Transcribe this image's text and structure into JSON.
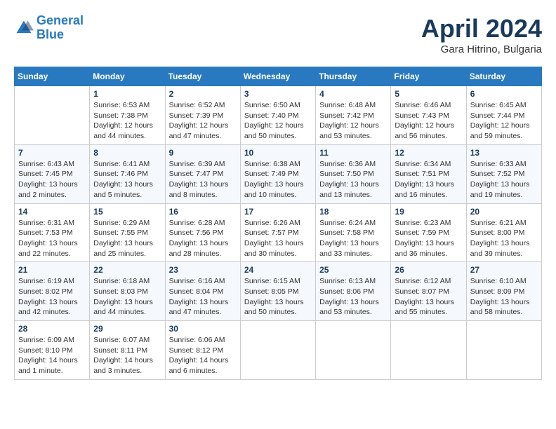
{
  "header": {
    "logo_line1": "General",
    "logo_line2": "Blue",
    "month_title": "April 2024",
    "subtitle": "Gara Hitrino, Bulgaria"
  },
  "weekdays": [
    "Sunday",
    "Monday",
    "Tuesday",
    "Wednesday",
    "Thursday",
    "Friday",
    "Saturday"
  ],
  "weeks": [
    [
      {
        "day": "",
        "sunrise": "",
        "sunset": "",
        "daylight": ""
      },
      {
        "day": "1",
        "sunrise": "Sunrise: 6:53 AM",
        "sunset": "Sunset: 7:38 PM",
        "daylight": "Daylight: 12 hours and 44 minutes."
      },
      {
        "day": "2",
        "sunrise": "Sunrise: 6:52 AM",
        "sunset": "Sunset: 7:39 PM",
        "daylight": "Daylight: 12 hours and 47 minutes."
      },
      {
        "day": "3",
        "sunrise": "Sunrise: 6:50 AM",
        "sunset": "Sunset: 7:40 PM",
        "daylight": "Daylight: 12 hours and 50 minutes."
      },
      {
        "day": "4",
        "sunrise": "Sunrise: 6:48 AM",
        "sunset": "Sunset: 7:42 PM",
        "daylight": "Daylight: 12 hours and 53 minutes."
      },
      {
        "day": "5",
        "sunrise": "Sunrise: 6:46 AM",
        "sunset": "Sunset: 7:43 PM",
        "daylight": "Daylight: 12 hours and 56 minutes."
      },
      {
        "day": "6",
        "sunrise": "Sunrise: 6:45 AM",
        "sunset": "Sunset: 7:44 PM",
        "daylight": "Daylight: 12 hours and 59 minutes."
      }
    ],
    [
      {
        "day": "7",
        "sunrise": "Sunrise: 6:43 AM",
        "sunset": "Sunset: 7:45 PM",
        "daylight": "Daylight: 13 hours and 2 minutes."
      },
      {
        "day": "8",
        "sunrise": "Sunrise: 6:41 AM",
        "sunset": "Sunset: 7:46 PM",
        "daylight": "Daylight: 13 hours and 5 minutes."
      },
      {
        "day": "9",
        "sunrise": "Sunrise: 6:39 AM",
        "sunset": "Sunset: 7:47 PM",
        "daylight": "Daylight: 13 hours and 8 minutes."
      },
      {
        "day": "10",
        "sunrise": "Sunrise: 6:38 AM",
        "sunset": "Sunset: 7:49 PM",
        "daylight": "Daylight: 13 hours and 10 minutes."
      },
      {
        "day": "11",
        "sunrise": "Sunrise: 6:36 AM",
        "sunset": "Sunset: 7:50 PM",
        "daylight": "Daylight: 13 hours and 13 minutes."
      },
      {
        "day": "12",
        "sunrise": "Sunrise: 6:34 AM",
        "sunset": "Sunset: 7:51 PM",
        "daylight": "Daylight: 13 hours and 16 minutes."
      },
      {
        "day": "13",
        "sunrise": "Sunrise: 6:33 AM",
        "sunset": "Sunset: 7:52 PM",
        "daylight": "Daylight: 13 hours and 19 minutes."
      }
    ],
    [
      {
        "day": "14",
        "sunrise": "Sunrise: 6:31 AM",
        "sunset": "Sunset: 7:53 PM",
        "daylight": "Daylight: 13 hours and 22 minutes."
      },
      {
        "day": "15",
        "sunrise": "Sunrise: 6:29 AM",
        "sunset": "Sunset: 7:55 PM",
        "daylight": "Daylight: 13 hours and 25 minutes."
      },
      {
        "day": "16",
        "sunrise": "Sunrise: 6:28 AM",
        "sunset": "Sunset: 7:56 PM",
        "daylight": "Daylight: 13 hours and 28 minutes."
      },
      {
        "day": "17",
        "sunrise": "Sunrise: 6:26 AM",
        "sunset": "Sunset: 7:57 PM",
        "daylight": "Daylight: 13 hours and 30 minutes."
      },
      {
        "day": "18",
        "sunrise": "Sunrise: 6:24 AM",
        "sunset": "Sunset: 7:58 PM",
        "daylight": "Daylight: 13 hours and 33 minutes."
      },
      {
        "day": "19",
        "sunrise": "Sunrise: 6:23 AM",
        "sunset": "Sunset: 7:59 PM",
        "daylight": "Daylight: 13 hours and 36 minutes."
      },
      {
        "day": "20",
        "sunrise": "Sunrise: 6:21 AM",
        "sunset": "Sunset: 8:00 PM",
        "daylight": "Daylight: 13 hours and 39 minutes."
      }
    ],
    [
      {
        "day": "21",
        "sunrise": "Sunrise: 6:19 AM",
        "sunset": "Sunset: 8:02 PM",
        "daylight": "Daylight: 13 hours and 42 minutes."
      },
      {
        "day": "22",
        "sunrise": "Sunrise: 6:18 AM",
        "sunset": "Sunset: 8:03 PM",
        "daylight": "Daylight: 13 hours and 44 minutes."
      },
      {
        "day": "23",
        "sunrise": "Sunrise: 6:16 AM",
        "sunset": "Sunset: 8:04 PM",
        "daylight": "Daylight: 13 hours and 47 minutes."
      },
      {
        "day": "24",
        "sunrise": "Sunrise: 6:15 AM",
        "sunset": "Sunset: 8:05 PM",
        "daylight": "Daylight: 13 hours and 50 minutes."
      },
      {
        "day": "25",
        "sunrise": "Sunrise: 6:13 AM",
        "sunset": "Sunset: 8:06 PM",
        "daylight": "Daylight: 13 hours and 53 minutes."
      },
      {
        "day": "26",
        "sunrise": "Sunrise: 6:12 AM",
        "sunset": "Sunset: 8:07 PM",
        "daylight": "Daylight: 13 hours and 55 minutes."
      },
      {
        "day": "27",
        "sunrise": "Sunrise: 6:10 AM",
        "sunset": "Sunset: 8:09 PM",
        "daylight": "Daylight: 13 hours and 58 minutes."
      }
    ],
    [
      {
        "day": "28",
        "sunrise": "Sunrise: 6:09 AM",
        "sunset": "Sunset: 8:10 PM",
        "daylight": "Daylight: 14 hours and 1 minute."
      },
      {
        "day": "29",
        "sunrise": "Sunrise: 6:07 AM",
        "sunset": "Sunset: 8:11 PM",
        "daylight": "Daylight: 14 hours and 3 minutes."
      },
      {
        "day": "30",
        "sunrise": "Sunrise: 6:06 AM",
        "sunset": "Sunset: 8:12 PM",
        "daylight": "Daylight: 14 hours and 6 minutes."
      },
      {
        "day": "",
        "sunrise": "",
        "sunset": "",
        "daylight": ""
      },
      {
        "day": "",
        "sunrise": "",
        "sunset": "",
        "daylight": ""
      },
      {
        "day": "",
        "sunrise": "",
        "sunset": "",
        "daylight": ""
      },
      {
        "day": "",
        "sunrise": "",
        "sunset": "",
        "daylight": ""
      }
    ]
  ]
}
